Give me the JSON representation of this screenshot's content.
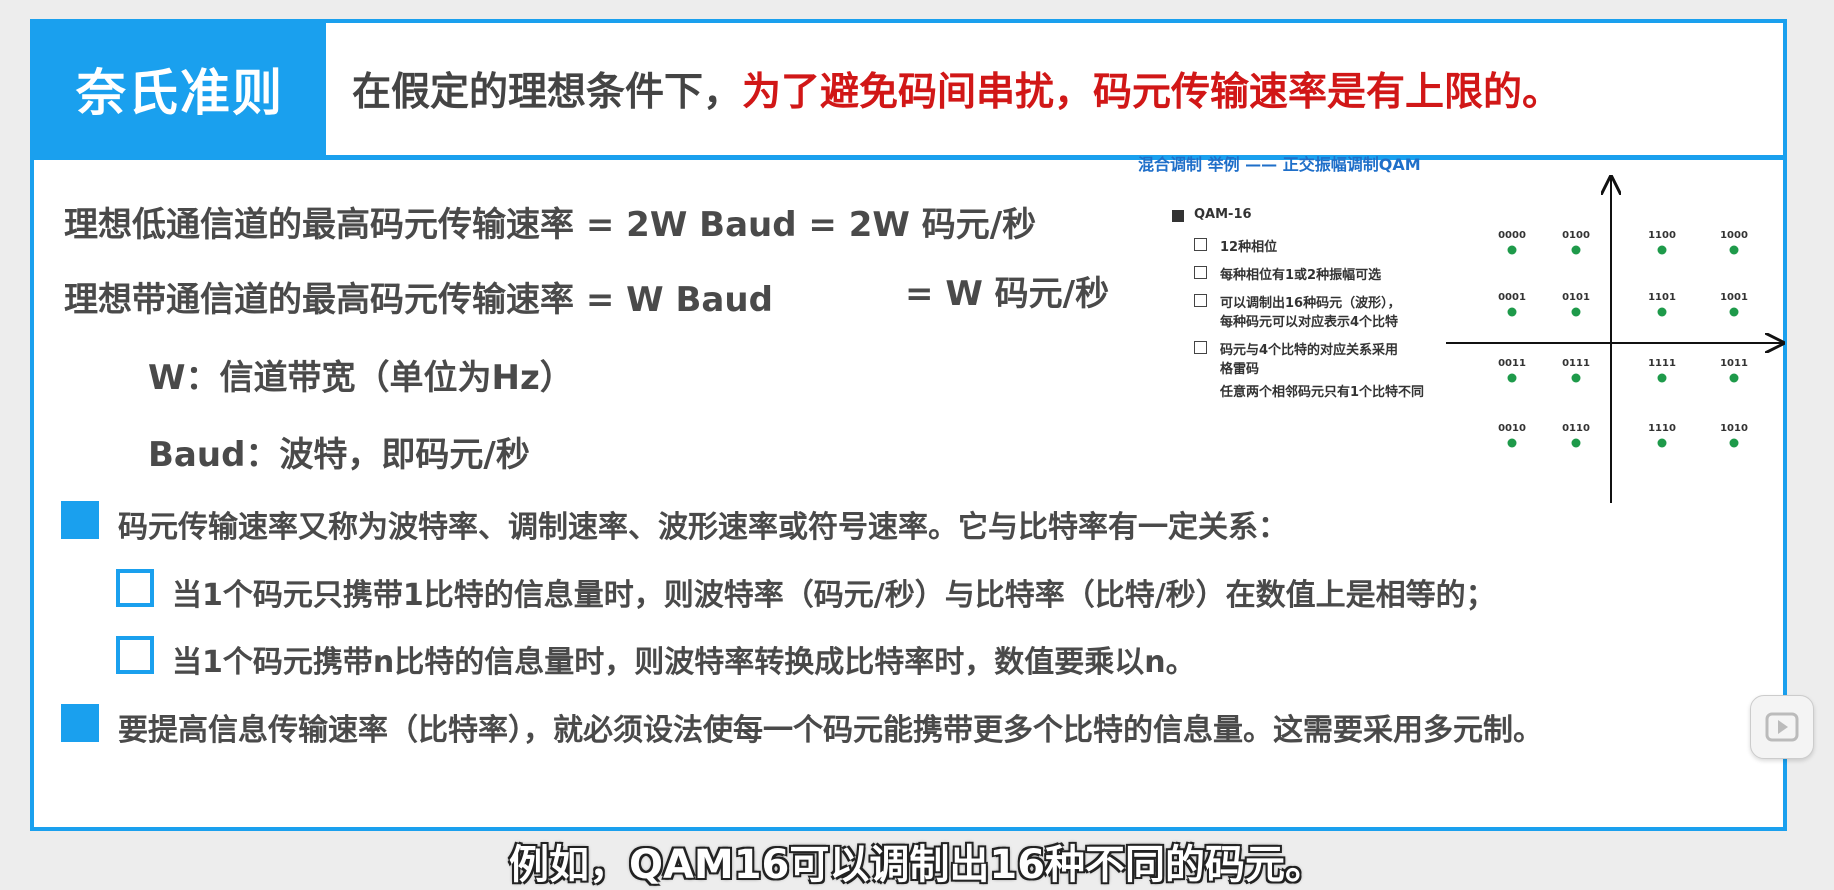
{
  "header": {
    "title": "奈氏准则",
    "headline_part1": "在假定的理想条件下，",
    "headline_part2": "为了避免码间串扰，",
    "headline_part3": "码元传输速率是有上限的。"
  },
  "body": {
    "lowpass": "理想低通信道的最高码元传输速率 = 2W Baud = 2W 码元/秒",
    "bandpass_a": "理想带通信道的最高码元传输速率 = W Baud",
    "bandpass_b": "= W 码元/秒",
    "w_def": "W：信道带宽（单位为Hz）",
    "baud_def": "Baud：波特，即码元/秒",
    "bullet1": "码元传输速率又称为波特率、调制速率、波形速率或符号速率。它与比特率有一定关系：",
    "sub1": "当1个码元只携带1比特的信息量时，则波特率（码元/秒）与比特率（比特/秒）在数值上是相等的；",
    "sub2": "当1个码元携带n比特的信息量时，则波特率转换成比特率时，数值要乘以n。",
    "bullet2": "要提高信息传输速率（比特率），就必须设法使每一个码元能携带更多个比特的信息量。这需要采用多元制。"
  },
  "qam": {
    "title": "混合调制 举例 —— 正交振幅调制QAM",
    "head": "QAM-16",
    "items": [
      "12种相位",
      "每种相位有1或2种振幅可选",
      "可以调制出16种码元（波形），",
      "每种码元可以对应表示4个比特",
      "码元与4个比特的对应关系采用",
      "格雷码",
      "任意两个相邻码元只有1个比特不同"
    ],
    "rows": [
      [
        "0000",
        "0100",
        "1100",
        "1000"
      ],
      [
        "0001",
        "0101",
        "1101",
        "1001"
      ],
      [
        "0011",
        "0111",
        "1111",
        "1011"
      ],
      [
        "0010",
        "0110",
        "1110",
        "1010"
      ]
    ],
    "dot_color": "#1e9a4a"
  },
  "subtitle": "例如，QAM16可以调制出16种不同的码元。",
  "colors": {
    "accent": "#1aa0ee",
    "highlight": "#d11717"
  },
  "player": {
    "icon": "play-icon"
  }
}
